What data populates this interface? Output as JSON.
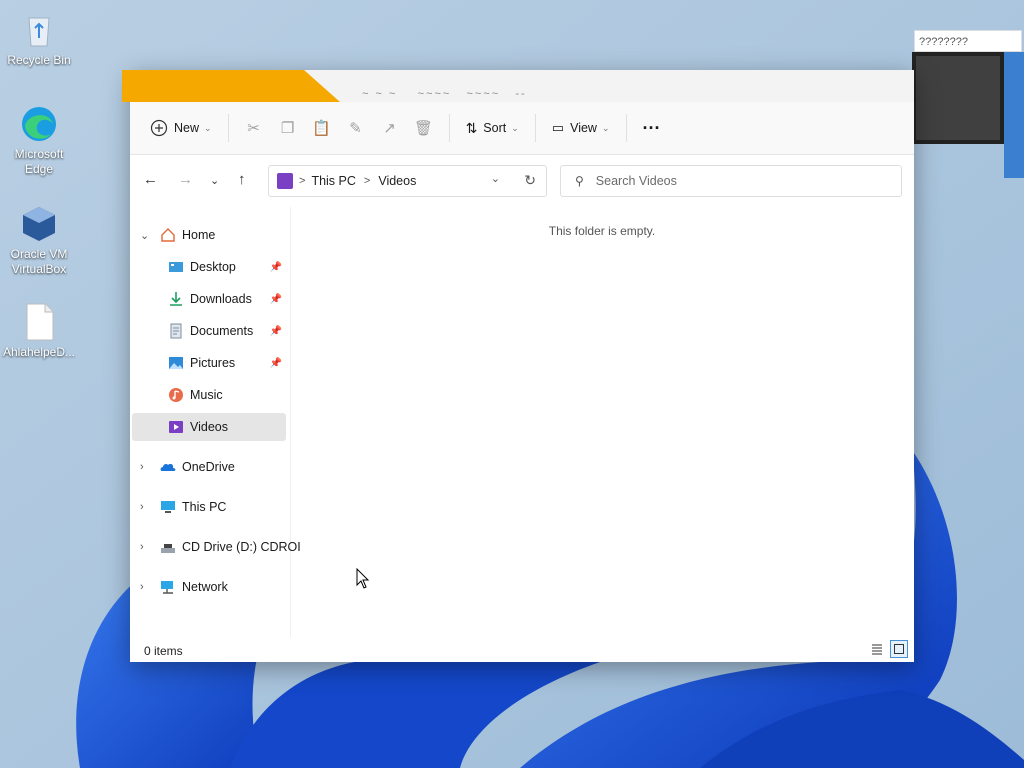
{
  "desktop": {
    "icons": [
      {
        "label": "Recycle Bin",
        "icon": "recycle-bin-icon"
      },
      {
        "label": "Microsoft Edge",
        "icon": "edge-icon"
      },
      {
        "label": "Oracle VM VirtualBox",
        "icon": "virtualbox-icon"
      },
      {
        "label": "AhlahelpeD...",
        "icon": "file-icon"
      }
    ]
  },
  "background_window": {
    "title": "????????"
  },
  "explorer": {
    "toolbar": {
      "new_label": "New",
      "sort_label": "Sort",
      "view_label": "View",
      "more_label": "···",
      "icons": [
        "cut-icon",
        "copy-icon",
        "paste-icon",
        "rename-icon",
        "share-icon",
        "delete-icon"
      ]
    },
    "address": {
      "segments": [
        "This PC",
        "Videos"
      ],
      "separator": ">"
    },
    "search": {
      "placeholder": "Search Videos"
    },
    "nav": {
      "home": "Home",
      "quick_access": [
        {
          "label": "Desktop",
          "icon": "desktop-folder-icon",
          "pinned": true
        },
        {
          "label": "Downloads",
          "icon": "download-icon",
          "pinned": true
        },
        {
          "label": "Documents",
          "icon": "documents-icon",
          "pinned": true
        },
        {
          "label": "Pictures",
          "icon": "pictures-icon",
          "pinned": true
        },
        {
          "label": "Music",
          "icon": "music-icon",
          "pinned": false
        },
        {
          "label": "Videos",
          "icon": "videos-icon",
          "pinned": false,
          "selected": true
        }
      ],
      "roots": [
        {
          "label": "OneDrive",
          "icon": "onedrive-icon"
        },
        {
          "label": "This PC",
          "icon": "this-pc-icon"
        },
        {
          "label": "CD Drive (D:) CDROI",
          "icon": "cd-drive-icon"
        },
        {
          "label": "Network",
          "icon": "network-icon"
        }
      ]
    },
    "content": {
      "empty_message": "This folder is empty."
    },
    "status": {
      "item_count": "0 items"
    }
  },
  "colors": {
    "accent": "#0067c0",
    "tab_accent": "#f5a800",
    "selection": "#e5e5e5",
    "wallpaper_blue": "#1a56d6"
  }
}
